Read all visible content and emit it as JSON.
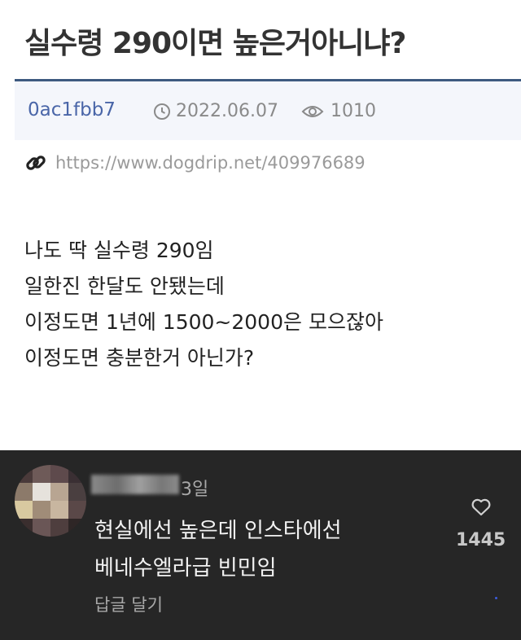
{
  "post": {
    "title": "실수령 290이면 높은거아니냐?",
    "author": "0ac1fbb7",
    "date": "2022.06.07",
    "views": "1010",
    "link": "https://www.dogdrip.net/409976689",
    "body_lines": [
      "나도 딱 실수령 290임",
      "일한진 한달도 안됐는데",
      "이정도면 1년에 1500~2000은 모으잖아",
      "이정도면 충분한거 아닌가?"
    ]
  },
  "comment": {
    "time_ago": "3일",
    "text_lines": [
      "현실에선 높은데 인스타에선",
      "베네수엘라급 빈민임"
    ],
    "reply_label": "답글 달기",
    "like_count": "1445"
  },
  "colors": {
    "author": "#4a66a8",
    "meta_border": "#3d5a80",
    "comment_bg": "#262626"
  },
  "icons": {
    "date": "clock-icon",
    "views": "eye-icon",
    "link": "link-icon",
    "like": "heart-icon"
  }
}
